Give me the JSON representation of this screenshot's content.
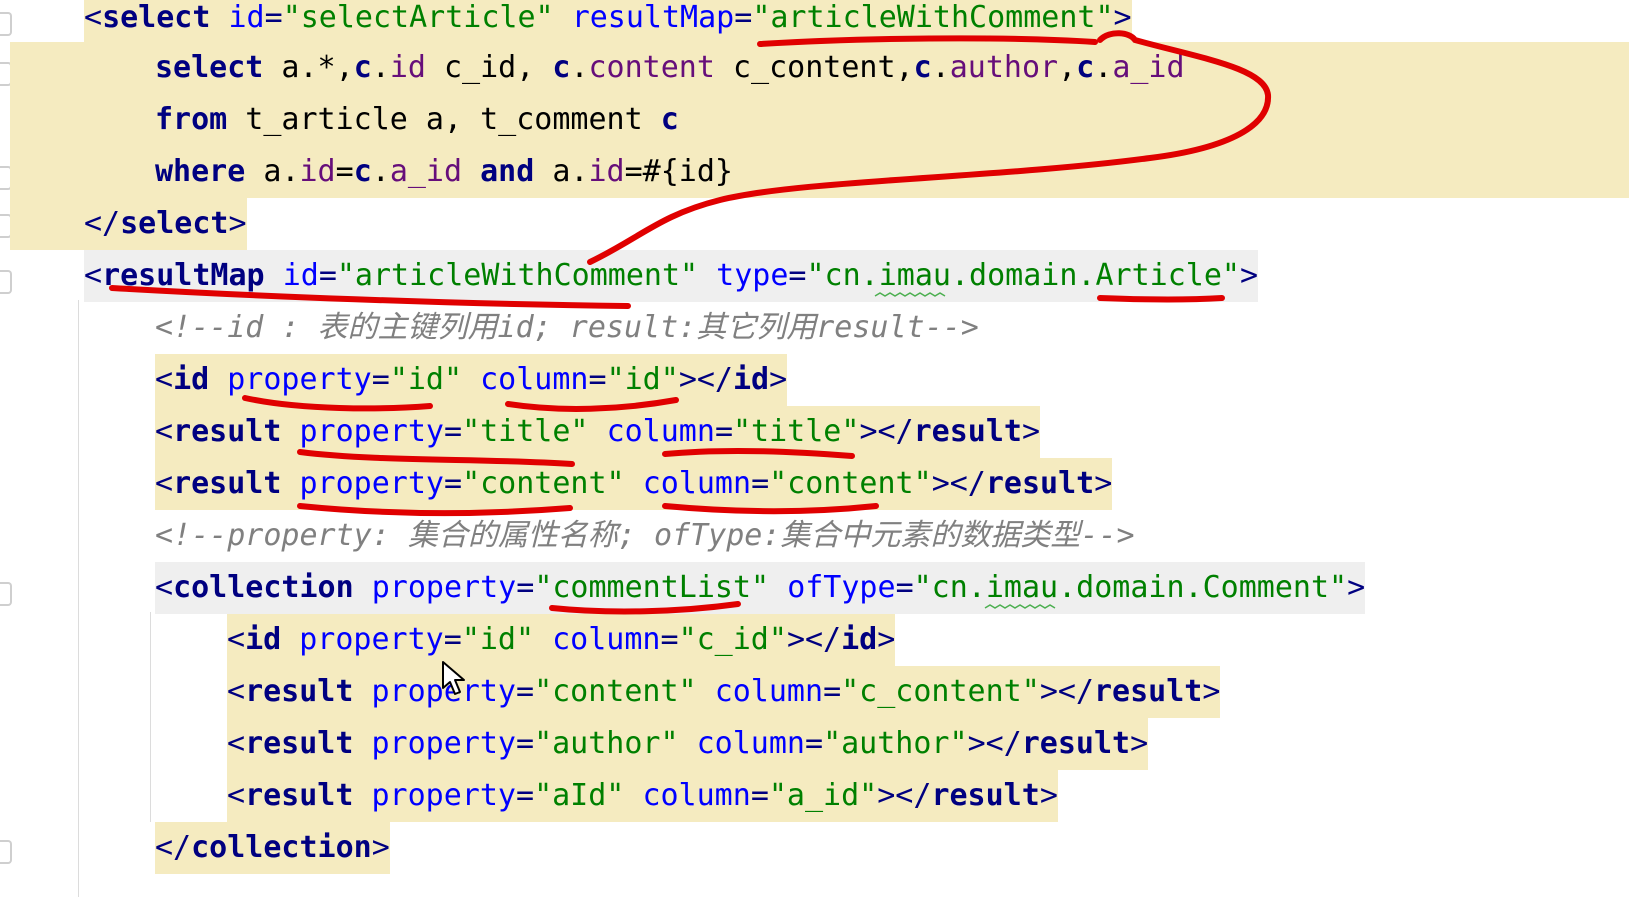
{
  "editor": {
    "lines": [
      [
        {
          "t": "<",
          "c": "tag"
        },
        {
          "t": "select",
          "c": "name"
        },
        {
          "t": " ",
          "c": ""
        },
        {
          "t": "id",
          "c": "attr"
        },
        {
          "t": "=",
          "c": "tag"
        },
        {
          "t": "\"selectArticle\"",
          "c": "str"
        },
        {
          "t": " ",
          "c": ""
        },
        {
          "t": "resultMap",
          "c": "attr"
        },
        {
          "t": "=",
          "c": "tag"
        },
        {
          "t": "\"articleWithComment\"",
          "c": "str"
        },
        {
          "t": ">",
          "c": "tag"
        }
      ],
      [
        {
          "t": "select",
          "c": "kw"
        },
        {
          "t": " a.*,",
          "c": ""
        },
        {
          "t": "c",
          "c": "kw"
        },
        {
          "t": ".",
          "c": ""
        },
        {
          "t": "id",
          "c": "field"
        },
        {
          "t": " c_id, ",
          "c": ""
        },
        {
          "t": "c",
          "c": "kw"
        },
        {
          "t": ".",
          "c": ""
        },
        {
          "t": "content",
          "c": "field"
        },
        {
          "t": " c_content,",
          "c": ""
        },
        {
          "t": "c",
          "c": "kw"
        },
        {
          "t": ".",
          "c": ""
        },
        {
          "t": "author",
          "c": "field"
        },
        {
          "t": ",",
          "c": ""
        },
        {
          "t": "c",
          "c": "kw"
        },
        {
          "t": ".",
          "c": ""
        },
        {
          "t": "a_id",
          "c": "field"
        }
      ],
      [
        {
          "t": "from",
          "c": "kw"
        },
        {
          "t": " t_article a, t_comment ",
          "c": ""
        },
        {
          "t": "c",
          "c": "kw"
        }
      ],
      [
        {
          "t": "where",
          "c": "kw"
        },
        {
          "t": " a.",
          "c": ""
        },
        {
          "t": "id",
          "c": "field"
        },
        {
          "t": "=",
          "c": ""
        },
        {
          "t": "c",
          "c": "kw"
        },
        {
          "t": ".",
          "c": ""
        },
        {
          "t": "a_id",
          "c": "field"
        },
        {
          "t": " ",
          "c": ""
        },
        {
          "t": "and",
          "c": "kw"
        },
        {
          "t": " a.",
          "c": ""
        },
        {
          "t": "id",
          "c": "field"
        },
        {
          "t": "=#{id}",
          "c": ""
        }
      ],
      [
        {
          "t": "</",
          "c": "tag"
        },
        {
          "t": "select",
          "c": "name"
        },
        {
          "t": ">",
          "c": "tag"
        }
      ],
      [
        {
          "t": "<",
          "c": "tag"
        },
        {
          "t": "resultMap",
          "c": "name"
        },
        {
          "t": " ",
          "c": ""
        },
        {
          "t": "id",
          "c": "attr"
        },
        {
          "t": "=",
          "c": "tag"
        },
        {
          "t": "\"articleWithComment\"",
          "c": "str"
        },
        {
          "t": " ",
          "c": ""
        },
        {
          "t": "type",
          "c": "attr"
        },
        {
          "t": "=",
          "c": "tag"
        },
        {
          "t": "\"cn.imau.domain.Article\"",
          "c": "str"
        },
        {
          "t": ">",
          "c": "tag"
        }
      ],
      [
        {
          "t": "<!--id : 表的主键列用id; result:其它列用result-->",
          "c": "cm"
        }
      ],
      [
        {
          "t": "<",
          "c": "tag"
        },
        {
          "t": "id",
          "c": "name"
        },
        {
          "t": " ",
          "c": ""
        },
        {
          "t": "property",
          "c": "attr"
        },
        {
          "t": "=",
          "c": "tag"
        },
        {
          "t": "\"id\"",
          "c": "str"
        },
        {
          "t": " ",
          "c": ""
        },
        {
          "t": "column",
          "c": "attr"
        },
        {
          "t": "=",
          "c": "tag"
        },
        {
          "t": "\"id\"",
          "c": "str"
        },
        {
          "t": "></",
          "c": "tag"
        },
        {
          "t": "id",
          "c": "name"
        },
        {
          "t": ">",
          "c": "tag"
        }
      ],
      [
        {
          "t": "<",
          "c": "tag"
        },
        {
          "t": "result",
          "c": "name"
        },
        {
          "t": " ",
          "c": ""
        },
        {
          "t": "property",
          "c": "attr"
        },
        {
          "t": "=",
          "c": "tag"
        },
        {
          "t": "\"title\"",
          "c": "str"
        },
        {
          "t": " ",
          "c": ""
        },
        {
          "t": "column",
          "c": "attr"
        },
        {
          "t": "=",
          "c": "tag"
        },
        {
          "t": "\"title\"",
          "c": "str"
        },
        {
          "t": "></",
          "c": "tag"
        },
        {
          "t": "result",
          "c": "name"
        },
        {
          "t": ">",
          "c": "tag"
        }
      ],
      [
        {
          "t": "<",
          "c": "tag"
        },
        {
          "t": "result",
          "c": "name"
        },
        {
          "t": " ",
          "c": ""
        },
        {
          "t": "property",
          "c": "attr"
        },
        {
          "t": "=",
          "c": "tag"
        },
        {
          "t": "\"content\"",
          "c": "str"
        },
        {
          "t": " ",
          "c": ""
        },
        {
          "t": "column",
          "c": "attr"
        },
        {
          "t": "=",
          "c": "tag"
        },
        {
          "t": "\"content\"",
          "c": "str"
        },
        {
          "t": "></",
          "c": "tag"
        },
        {
          "t": "result",
          "c": "name"
        },
        {
          "t": ">",
          "c": "tag"
        }
      ],
      [
        {
          "t": "<!--property: 集合的属性名称; ofType:集合中元素的数据类型-->",
          "c": "cm"
        }
      ],
      [
        {
          "t": "<",
          "c": "tag"
        },
        {
          "t": "collection",
          "c": "name"
        },
        {
          "t": " ",
          "c": ""
        },
        {
          "t": "property",
          "c": "attr"
        },
        {
          "t": "=",
          "c": "tag"
        },
        {
          "t": "\"commentList\"",
          "c": "str"
        },
        {
          "t": " ",
          "c": ""
        },
        {
          "t": "ofType",
          "c": "attr"
        },
        {
          "t": "=",
          "c": "tag"
        },
        {
          "t": "\"cn.imau.domain.Comment\"",
          "c": "str"
        },
        {
          "t": ">",
          "c": "tag"
        }
      ],
      [
        {
          "t": "<",
          "c": "tag"
        },
        {
          "t": "id",
          "c": "name"
        },
        {
          "t": " ",
          "c": ""
        },
        {
          "t": "property",
          "c": "attr"
        },
        {
          "t": "=",
          "c": "tag"
        },
        {
          "t": "\"id\"",
          "c": "str"
        },
        {
          "t": " ",
          "c": ""
        },
        {
          "t": "column",
          "c": "attr"
        },
        {
          "t": "=",
          "c": "tag"
        },
        {
          "t": "\"c_id\"",
          "c": "str"
        },
        {
          "t": "></",
          "c": "tag"
        },
        {
          "t": "id",
          "c": "name"
        },
        {
          "t": ">",
          "c": "tag"
        }
      ],
      [
        {
          "t": "<",
          "c": "tag"
        },
        {
          "t": "result",
          "c": "name"
        },
        {
          "t": " ",
          "c": ""
        },
        {
          "t": "property",
          "c": "attr"
        },
        {
          "t": "=",
          "c": "tag"
        },
        {
          "t": "\"content\"",
          "c": "str"
        },
        {
          "t": " ",
          "c": ""
        },
        {
          "t": "column",
          "c": "attr"
        },
        {
          "t": "=",
          "c": "tag"
        },
        {
          "t": "\"c_content\"",
          "c": "str"
        },
        {
          "t": "></",
          "c": "tag"
        },
        {
          "t": "result",
          "c": "name"
        },
        {
          "t": ">",
          "c": "tag"
        }
      ],
      [
        {
          "t": "<",
          "c": "tag"
        },
        {
          "t": "result",
          "c": "name"
        },
        {
          "t": " ",
          "c": ""
        },
        {
          "t": "property",
          "c": "attr"
        },
        {
          "t": "=",
          "c": "tag"
        },
        {
          "t": "\"author\"",
          "c": "str"
        },
        {
          "t": " ",
          "c": ""
        },
        {
          "t": "column",
          "c": "attr"
        },
        {
          "t": "=",
          "c": "tag"
        },
        {
          "t": "\"author\"",
          "c": "str"
        },
        {
          "t": "></",
          "c": "tag"
        },
        {
          "t": "result",
          "c": "name"
        },
        {
          "t": ">",
          "c": "tag"
        }
      ],
      [
        {
          "t": "<",
          "c": "tag"
        },
        {
          "t": "result",
          "c": "name"
        },
        {
          "t": " ",
          "c": ""
        },
        {
          "t": "property",
          "c": "attr"
        },
        {
          "t": "=",
          "c": "tag"
        },
        {
          "t": "\"aId\"",
          "c": "str"
        },
        {
          "t": " ",
          "c": ""
        },
        {
          "t": "column",
          "c": "attr"
        },
        {
          "t": "=",
          "c": "tag"
        },
        {
          "t": "\"a_id\"",
          "c": "str"
        },
        {
          "t": "></",
          "c": "tag"
        },
        {
          "t": "result",
          "c": "name"
        },
        {
          "t": ">",
          "c": "tag"
        }
      ],
      [
        {
          "t": "</",
          "c": "tag"
        },
        {
          "t": "collection",
          "c": "name"
        },
        {
          "t": ">",
          "c": "tag"
        }
      ]
    ],
    "colors": {
      "highlight": "#f5ebc0",
      "annotation": "#e00000"
    },
    "icons": [
      "fold-marker-icon",
      "mouse-pointer-icon"
    ]
  }
}
